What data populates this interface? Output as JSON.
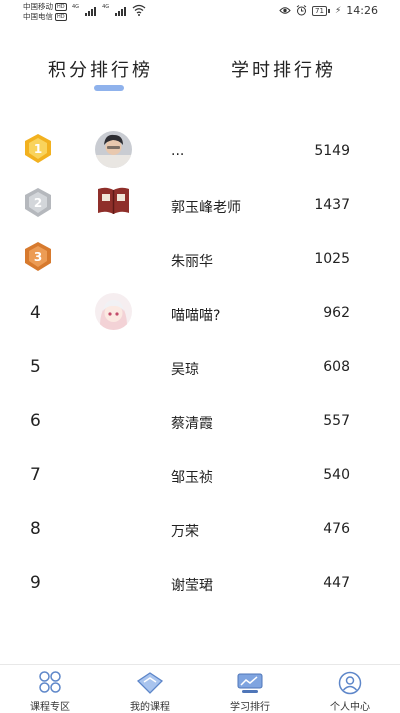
{
  "status_bar": {
    "carrier1": "中国移动",
    "carrier2": "中国电信",
    "hd": "HD",
    "net1": "4G",
    "net2": "4G",
    "battery": "71",
    "time": "14:26"
  },
  "tabs": [
    {
      "label": "积分排行榜",
      "active": true
    },
    {
      "label": "学时排行榜",
      "active": false
    }
  ],
  "accent_color": "#8fb2ec",
  "ranking": [
    {
      "rank": "1",
      "medal": "gold",
      "avatar": "photo-avatar",
      "name": "...",
      "score": "5149"
    },
    {
      "rank": "2",
      "medal": "silver",
      "avatar": "book-avatar",
      "name": "郭玉峰老师",
      "score": "1437"
    },
    {
      "rank": "3",
      "medal": "bronze",
      "avatar": "",
      "name": "朱丽华",
      "score": "1025"
    },
    {
      "rank": "4",
      "medal": "",
      "avatar": "anime-avatar",
      "name": "喵喵喵?",
      "score": "962"
    },
    {
      "rank": "5",
      "medal": "",
      "avatar": "",
      "name": "吴琼",
      "score": "608"
    },
    {
      "rank": "6",
      "medal": "",
      "avatar": "",
      "name": "蔡清霞",
      "score": "557"
    },
    {
      "rank": "7",
      "medal": "",
      "avatar": "",
      "name": "邹玉祯",
      "score": "540"
    },
    {
      "rank": "8",
      "medal": "",
      "avatar": "",
      "name": "万荣",
      "score": "476"
    },
    {
      "rank": "9",
      "medal": "",
      "avatar": "",
      "name": "谢莹珺",
      "score": "447"
    }
  ],
  "bottom_nav": [
    {
      "label": "课程专区",
      "icon": "course-area-icon"
    },
    {
      "label": "我的课程",
      "icon": "my-courses-icon"
    },
    {
      "label": "学习排行",
      "icon": "study-ranking-icon",
      "active": true
    },
    {
      "label": "个人中心",
      "icon": "personal-center-icon"
    }
  ]
}
